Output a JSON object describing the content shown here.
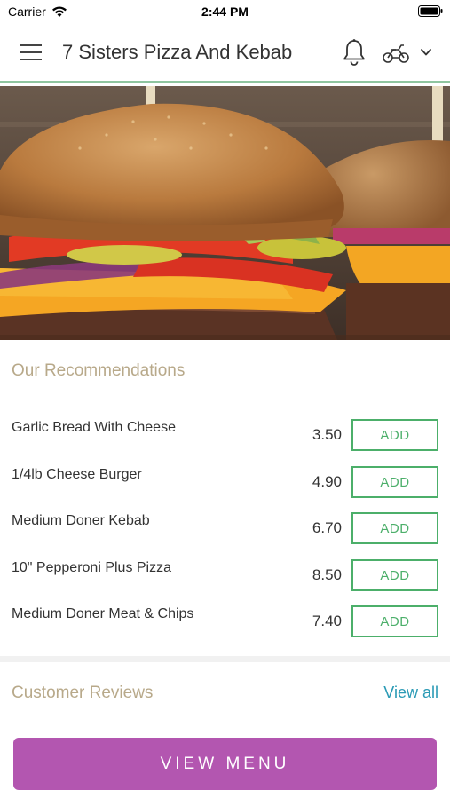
{
  "status_bar": {
    "carrier": "Carrier",
    "time": "2:44 PM"
  },
  "header": {
    "title": "7 Sisters Pizza And Kebab",
    "icons": [
      "hamburger-menu-icon",
      "bell-icon",
      "scooter-icon",
      "chevron-down-icon"
    ],
    "accent_color": "#8fc5a0"
  },
  "hero": {
    "icon": "burger-image"
  },
  "recommendations": {
    "title": "Our Recommendations",
    "add_label": "ADD",
    "items": [
      {
        "name": "Garlic Bread With Cheese",
        "price": "3.50"
      },
      {
        "name": "1/4lb Cheese Burger",
        "price": "4.90"
      },
      {
        "name": "Medium Doner Kebab",
        "price": "6.70"
      },
      {
        "name": "10\" Pepperoni Plus Pizza",
        "price": "8.50"
      },
      {
        "name": "Medium Doner Meat & Chips",
        "price": "7.40"
      }
    ]
  },
  "reviews": {
    "title": "Customer Reviews",
    "view_all_label": "View all"
  },
  "footer": {
    "view_menu_label": "VIEW MENU",
    "button_color": "#b356b0"
  },
  "colors": {
    "section_title": "#b8a98a",
    "add_button": "#4caf6a",
    "link": "#2a9ab5"
  }
}
